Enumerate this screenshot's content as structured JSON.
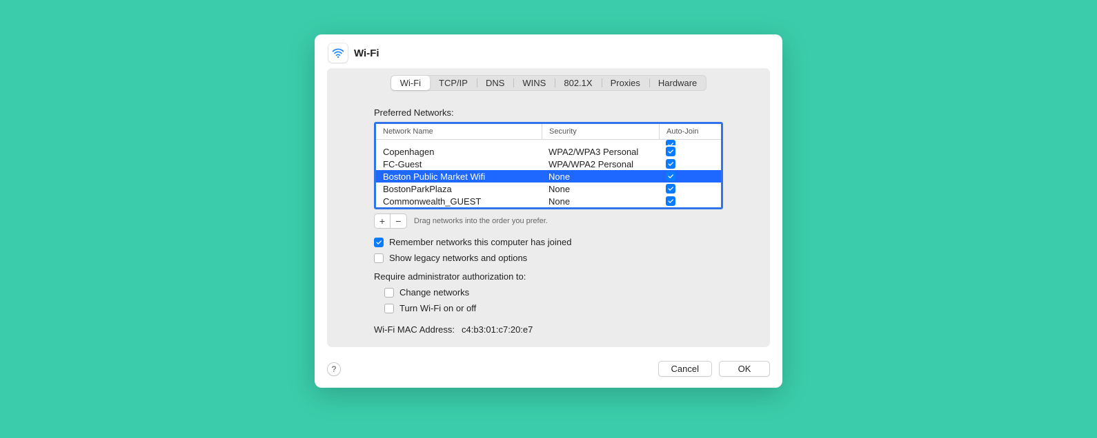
{
  "header": {
    "title": "Wi-Fi"
  },
  "tabs": [
    "Wi-Fi",
    "TCP/IP",
    "DNS",
    "WINS",
    "802.1X",
    "Proxies",
    "Hardware"
  ],
  "active_tab_index": 0,
  "preferred_label": "Preferred Networks:",
  "columns": {
    "name": "Network Name",
    "security": "Security",
    "auto": "Auto-Join"
  },
  "networks": [
    {
      "name": "Copenhagen",
      "security": "WPA2/WPA3 Personal",
      "auto": true,
      "selected": false
    },
    {
      "name": "FC-Guest",
      "security": "WPA/WPA2 Personal",
      "auto": true,
      "selected": false
    },
    {
      "name": "Boston Public Market Wifi",
      "security": "None",
      "auto": true,
      "selected": true
    },
    {
      "name": "BostonParkPlaza",
      "security": "None",
      "auto": true,
      "selected": false
    },
    {
      "name": "Commonwealth_GUEST",
      "security": "None",
      "auto": true,
      "selected": false
    }
  ],
  "drag_hint": "Drag networks into the order you prefer.",
  "checks": {
    "remember": {
      "label": "Remember networks this computer has joined",
      "on": true
    },
    "legacy": {
      "label": "Show legacy networks and options",
      "on": false
    }
  },
  "require_label": "Require administrator authorization to:",
  "require": {
    "change": {
      "label": "Change networks",
      "on": false
    },
    "toggle": {
      "label": "Turn Wi-Fi on or off",
      "on": false
    }
  },
  "mac": {
    "label": "Wi-Fi MAC Address:",
    "value": "c4:b3:01:c7:20:e7"
  },
  "footer": {
    "help": "?",
    "cancel": "Cancel",
    "ok": "OK"
  },
  "buttons": {
    "add": "+",
    "remove": "−"
  }
}
